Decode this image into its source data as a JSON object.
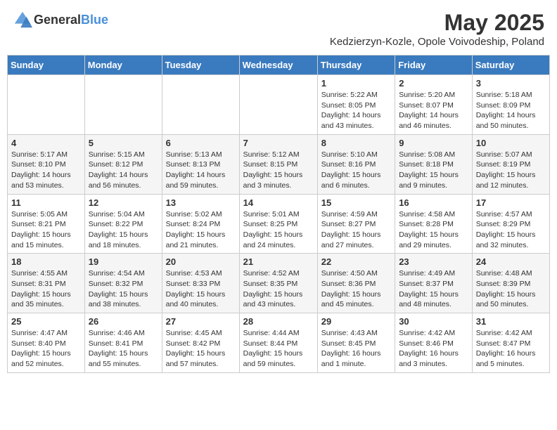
{
  "header": {
    "logo_general": "General",
    "logo_blue": "Blue",
    "title": "May 2025",
    "location": "Kedzierzyn-Kozle, Opole Voivodeship, Poland"
  },
  "days_of_week": [
    "Sunday",
    "Monday",
    "Tuesday",
    "Wednesday",
    "Thursday",
    "Friday",
    "Saturday"
  ],
  "weeks": [
    [
      {
        "day": "",
        "info": ""
      },
      {
        "day": "",
        "info": ""
      },
      {
        "day": "",
        "info": ""
      },
      {
        "day": "",
        "info": ""
      },
      {
        "day": "1",
        "info": "Sunrise: 5:22 AM\nSunset: 8:05 PM\nDaylight: 14 hours and 43 minutes."
      },
      {
        "day": "2",
        "info": "Sunrise: 5:20 AM\nSunset: 8:07 PM\nDaylight: 14 hours and 46 minutes."
      },
      {
        "day": "3",
        "info": "Sunrise: 5:18 AM\nSunset: 8:09 PM\nDaylight: 14 hours and 50 minutes."
      }
    ],
    [
      {
        "day": "4",
        "info": "Sunrise: 5:17 AM\nSunset: 8:10 PM\nDaylight: 14 hours and 53 minutes."
      },
      {
        "day": "5",
        "info": "Sunrise: 5:15 AM\nSunset: 8:12 PM\nDaylight: 14 hours and 56 minutes."
      },
      {
        "day": "6",
        "info": "Sunrise: 5:13 AM\nSunset: 8:13 PM\nDaylight: 14 hours and 59 minutes."
      },
      {
        "day": "7",
        "info": "Sunrise: 5:12 AM\nSunset: 8:15 PM\nDaylight: 15 hours and 3 minutes."
      },
      {
        "day": "8",
        "info": "Sunrise: 5:10 AM\nSunset: 8:16 PM\nDaylight: 15 hours and 6 minutes."
      },
      {
        "day": "9",
        "info": "Sunrise: 5:08 AM\nSunset: 8:18 PM\nDaylight: 15 hours and 9 minutes."
      },
      {
        "day": "10",
        "info": "Sunrise: 5:07 AM\nSunset: 8:19 PM\nDaylight: 15 hours and 12 minutes."
      }
    ],
    [
      {
        "day": "11",
        "info": "Sunrise: 5:05 AM\nSunset: 8:21 PM\nDaylight: 15 hours and 15 minutes."
      },
      {
        "day": "12",
        "info": "Sunrise: 5:04 AM\nSunset: 8:22 PM\nDaylight: 15 hours and 18 minutes."
      },
      {
        "day": "13",
        "info": "Sunrise: 5:02 AM\nSunset: 8:24 PM\nDaylight: 15 hours and 21 minutes."
      },
      {
        "day": "14",
        "info": "Sunrise: 5:01 AM\nSunset: 8:25 PM\nDaylight: 15 hours and 24 minutes."
      },
      {
        "day": "15",
        "info": "Sunrise: 4:59 AM\nSunset: 8:27 PM\nDaylight: 15 hours and 27 minutes."
      },
      {
        "day": "16",
        "info": "Sunrise: 4:58 AM\nSunset: 8:28 PM\nDaylight: 15 hours and 29 minutes."
      },
      {
        "day": "17",
        "info": "Sunrise: 4:57 AM\nSunset: 8:29 PM\nDaylight: 15 hours and 32 minutes."
      }
    ],
    [
      {
        "day": "18",
        "info": "Sunrise: 4:55 AM\nSunset: 8:31 PM\nDaylight: 15 hours and 35 minutes."
      },
      {
        "day": "19",
        "info": "Sunrise: 4:54 AM\nSunset: 8:32 PM\nDaylight: 15 hours and 38 minutes."
      },
      {
        "day": "20",
        "info": "Sunrise: 4:53 AM\nSunset: 8:33 PM\nDaylight: 15 hours and 40 minutes."
      },
      {
        "day": "21",
        "info": "Sunrise: 4:52 AM\nSunset: 8:35 PM\nDaylight: 15 hours and 43 minutes."
      },
      {
        "day": "22",
        "info": "Sunrise: 4:50 AM\nSunset: 8:36 PM\nDaylight: 15 hours and 45 minutes."
      },
      {
        "day": "23",
        "info": "Sunrise: 4:49 AM\nSunset: 8:37 PM\nDaylight: 15 hours and 48 minutes."
      },
      {
        "day": "24",
        "info": "Sunrise: 4:48 AM\nSunset: 8:39 PM\nDaylight: 15 hours and 50 minutes."
      }
    ],
    [
      {
        "day": "25",
        "info": "Sunrise: 4:47 AM\nSunset: 8:40 PM\nDaylight: 15 hours and 52 minutes."
      },
      {
        "day": "26",
        "info": "Sunrise: 4:46 AM\nSunset: 8:41 PM\nDaylight: 15 hours and 55 minutes."
      },
      {
        "day": "27",
        "info": "Sunrise: 4:45 AM\nSunset: 8:42 PM\nDaylight: 15 hours and 57 minutes."
      },
      {
        "day": "28",
        "info": "Sunrise: 4:44 AM\nSunset: 8:44 PM\nDaylight: 15 hours and 59 minutes."
      },
      {
        "day": "29",
        "info": "Sunrise: 4:43 AM\nSunset: 8:45 PM\nDaylight: 16 hours and 1 minute."
      },
      {
        "day": "30",
        "info": "Sunrise: 4:42 AM\nSunset: 8:46 PM\nDaylight: 16 hours and 3 minutes."
      },
      {
        "day": "31",
        "info": "Sunrise: 4:42 AM\nSunset: 8:47 PM\nDaylight: 16 hours and 5 minutes."
      }
    ]
  ]
}
